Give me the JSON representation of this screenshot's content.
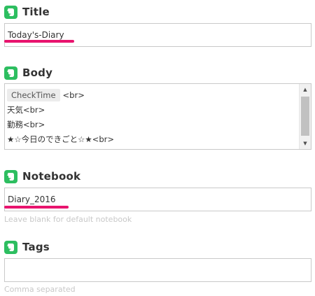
{
  "fields": {
    "title": {
      "label": "Title",
      "value": "Today's-Diary"
    },
    "body": {
      "label": "Body",
      "token": "CheckTime",
      "lines": [
        "<br>",
        "天気<br>",
        "勤務<br>",
        "★☆今日のできごと☆★<br>"
      ]
    },
    "notebook": {
      "label": "Notebook",
      "value": "Diary_2016",
      "hint": "Leave blank for default notebook"
    },
    "tags": {
      "label": "Tags",
      "value": "",
      "hint": "Comma separated"
    }
  },
  "icons": {
    "label_icon": "evernote-elephant-icon",
    "scroll_up": "scroll-up-arrow-icon",
    "scroll_down": "scroll-down-arrow-icon"
  },
  "colors": {
    "label_icon_bg": "#2dbe60",
    "highlight_underline": "#e8146e",
    "hint_text": "#c8c8c8",
    "input_border": "#c9c9c9"
  }
}
